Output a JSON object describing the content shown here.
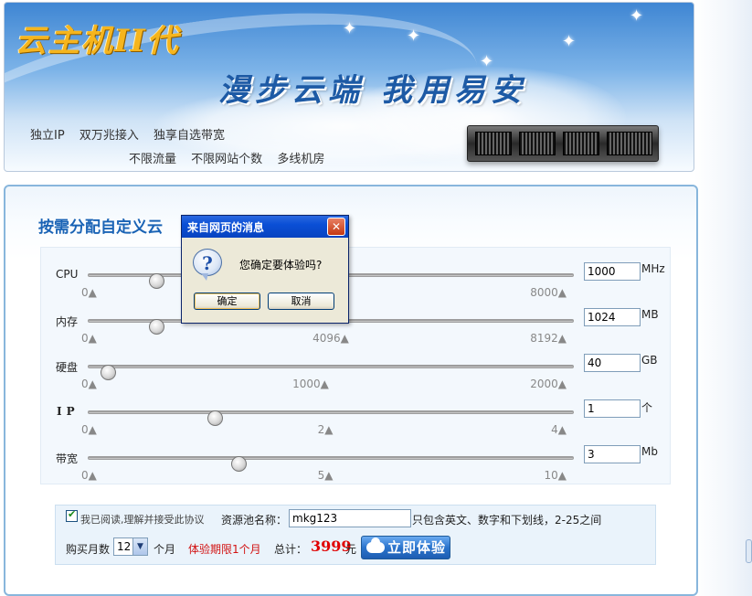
{
  "banner": {
    "logo": "云主机II代",
    "slogan": "漫步云端  我用易安",
    "features_row1": [
      "独立IP",
      "双万兆接入",
      "独享自选带宽"
    ],
    "features_row2": [
      "不限流量",
      "不限网站个数",
      "多线机房"
    ]
  },
  "panel": {
    "title": "按需分配自定义云"
  },
  "sliders": [
    {
      "label": "CPU",
      "value": "1000",
      "unit": "MHz",
      "ticks": [
        "0▲",
        "8000▲"
      ],
      "mid_tick": "",
      "fraction": 0.14
    },
    {
      "label": "内存",
      "value": "1024",
      "unit": "MB",
      "ticks": [
        "0▲",
        "8192▲"
      ],
      "mid_tick": "4096▲",
      "fraction": 0.14
    },
    {
      "label": "硬盘",
      "value": "40",
      "unit": "GB",
      "ticks": [
        "0▲",
        "2000▲"
      ],
      "mid_tick": "1000▲",
      "fraction": 0.04
    },
    {
      "label": "IP",
      "value": "1",
      "unit": "个",
      "ticks": [
        "0▲",
        "4▲"
      ],
      "mid_tick": "2▲",
      "fraction": 0.26
    },
    {
      "label": "带宽",
      "value": "3",
      "unit": "Mb",
      "ticks": [
        "0▲",
        "10▲"
      ],
      "mid_tick": "5▲",
      "fraction": 0.31
    }
  ],
  "order": {
    "agree_text": "我已阅读,理解并接受此协议",
    "agree_checked": true,
    "pool_label": "资源池名称：",
    "pool_value": "mkg123",
    "pool_hint": "只包含英文、数字和下划线，2-25之间",
    "months_label": "购买月数",
    "months_value": "12",
    "months_unit": "个月",
    "trial_text": "体验期限1个月",
    "total_label": "总计：",
    "total_value": "3999",
    "total_unit": "元",
    "try_button": "立即体验"
  },
  "dialog": {
    "title": "来自网页的消息",
    "message": "您确定要体验吗?",
    "ok": "确定",
    "cancel": "取消",
    "close": "✕"
  },
  "colors": {
    "title_blue": "#1a63b5",
    "price_red": "#e00000",
    "trial_red": "#d21212",
    "dialog_title": "#0a4fd6"
  }
}
